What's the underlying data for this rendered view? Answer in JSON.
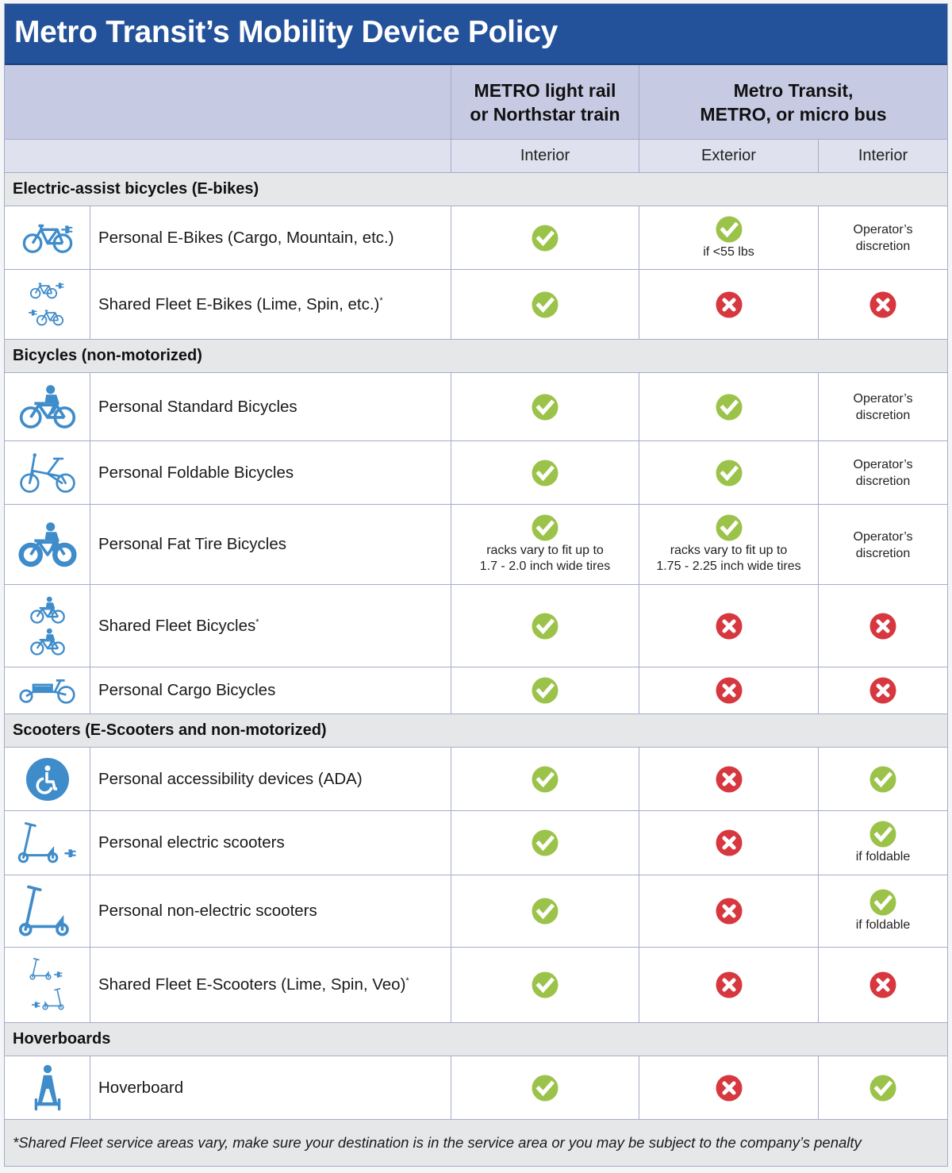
{
  "title": "Metro Transit’s Mobility Device Policy",
  "colors": {
    "header_blue": "#23529a",
    "allowed_green": "#9bc34a",
    "not_allowed_red": "#d7373e",
    "icon_blue": "#3f8ccb"
  },
  "columns": {
    "group_train": "METRO light rail\nor Northstar train",
    "group_train_line1": "METRO light rail",
    "group_train_line2": "or Northstar train",
    "group_bus_line1": "Metro Transit,",
    "group_bus_line2": "METRO, or micro bus",
    "train_interior": "Interior",
    "bus_exterior": "Exterior",
    "bus_interior": "Interior"
  },
  "status_legend": {
    "yes": "check-icon (allowed)",
    "no": "x-icon (not allowed)"
  },
  "categories": [
    {
      "label": "Electric-assist bicycles (E-bikes)",
      "items": [
        {
          "icon": "e-bike-icon",
          "name": "Personal E-Bikes (Cargo, Mountain, etc.)",
          "asterisk": false,
          "train_interior": {
            "status": "yes",
            "note": ""
          },
          "bus_exterior": {
            "status": "yes",
            "note": "if <55 lbs"
          },
          "bus_interior": {
            "status": "discretion",
            "note": "Operator’s discretion",
            "line1": "Operator’s",
            "line2": "discretion"
          }
        },
        {
          "icon": "shared-e-bikes-icon",
          "name": "Shared Fleet E-Bikes (Lime, Spin, etc.)",
          "asterisk": true,
          "train_interior": {
            "status": "yes",
            "note": ""
          },
          "bus_exterior": {
            "status": "no",
            "note": ""
          },
          "bus_interior": {
            "status": "no",
            "note": ""
          }
        }
      ]
    },
    {
      "label": "Bicycles (non-motorized)",
      "items": [
        {
          "icon": "cyclist-icon",
          "name": "Personal Standard Bicycles",
          "asterisk": false,
          "train_interior": {
            "status": "yes",
            "note": ""
          },
          "bus_exterior": {
            "status": "yes",
            "note": ""
          },
          "bus_interior": {
            "status": "discretion",
            "line1": "Operator’s",
            "line2": "discretion"
          }
        },
        {
          "icon": "folding-bike-icon",
          "name": "Personal Foldable Bicycles",
          "asterisk": false,
          "train_interior": {
            "status": "yes",
            "note": ""
          },
          "bus_exterior": {
            "status": "yes",
            "note": ""
          },
          "bus_interior": {
            "status": "discretion",
            "line1": "Operator’s",
            "line2": "discretion"
          }
        },
        {
          "icon": "fat-tire-bike-icon",
          "name": "Personal Fat Tire Bicycles",
          "asterisk": false,
          "train_interior": {
            "status": "yes",
            "line1": "racks vary to fit up to",
            "line2": "1.7 - 2.0 inch wide tires"
          },
          "bus_exterior": {
            "status": "yes",
            "line1": "racks vary to fit up to",
            "line2": "1.75 - 2.25 inch wide tires"
          },
          "bus_interior": {
            "status": "discretion",
            "line1": "Operator’s",
            "line2": "discretion"
          }
        },
        {
          "icon": "shared-bikes-icon",
          "name": "Shared Fleet Bicycles",
          "asterisk": true,
          "train_interior": {
            "status": "yes",
            "note": ""
          },
          "bus_exterior": {
            "status": "no",
            "note": ""
          },
          "bus_interior": {
            "status": "no",
            "note": ""
          }
        },
        {
          "icon": "cargo-bike-icon",
          "name": "Personal Cargo Bicycles",
          "asterisk": false,
          "train_interior": {
            "status": "yes",
            "note": ""
          },
          "bus_exterior": {
            "status": "no",
            "note": ""
          },
          "bus_interior": {
            "status": "no",
            "note": ""
          }
        }
      ]
    },
    {
      "label": "Scooters (E-Scooters and non-motorized)",
      "items": [
        {
          "icon": "wheelchair-icon",
          "name": "Personal accessibility devices (ADA)",
          "asterisk": false,
          "train_interior": {
            "status": "yes",
            "note": ""
          },
          "bus_exterior": {
            "status": "no",
            "note": ""
          },
          "bus_interior": {
            "status": "yes",
            "note": ""
          }
        },
        {
          "icon": "electric-scooter-icon",
          "name": "Personal electric scooters",
          "asterisk": false,
          "train_interior": {
            "status": "yes",
            "note": ""
          },
          "bus_exterior": {
            "status": "no",
            "note": ""
          },
          "bus_interior": {
            "status": "yes",
            "note": "if foldable"
          }
        },
        {
          "icon": "kick-scooter-icon",
          "name": "Personal non-electric scooters",
          "asterisk": false,
          "train_interior": {
            "status": "yes",
            "note": ""
          },
          "bus_exterior": {
            "status": "no",
            "note": ""
          },
          "bus_interior": {
            "status": "yes",
            "note": "if foldable"
          }
        },
        {
          "icon": "shared-e-scooters-icon",
          "name": "Shared Fleet E-Scooters (Lime, Spin, Veo)",
          "asterisk": true,
          "train_interior": {
            "status": "yes",
            "note": ""
          },
          "bus_exterior": {
            "status": "no",
            "note": ""
          },
          "bus_interior": {
            "status": "no",
            "note": ""
          }
        }
      ]
    },
    {
      "label": "Hoverboards",
      "items": [
        {
          "icon": "hoverboard-icon",
          "name": "Hoverboard",
          "asterisk": false,
          "train_interior": {
            "status": "yes",
            "note": ""
          },
          "bus_exterior": {
            "status": "no",
            "note": ""
          },
          "bus_interior": {
            "status": "yes",
            "note": ""
          }
        }
      ]
    }
  ],
  "asterisk_mark": "*",
  "footnote": "*Shared Fleet service areas vary, make sure your destination is in the service area or you may be subject to the company’s penalty"
}
